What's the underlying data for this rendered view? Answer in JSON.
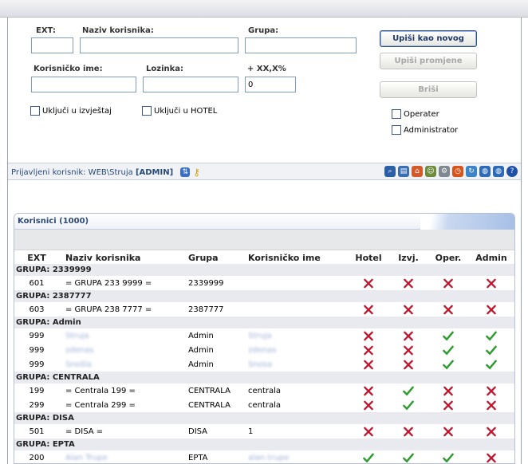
{
  "form": {
    "ext_label": "EXT:",
    "naziv_label": "Naziv korisnika:",
    "grupa_label": "Grupa:",
    "korisnicko_label": "Korisničko ime:",
    "lozinka_label": "Lozinka:",
    "postotak_label": "+ XX,X%",
    "postotak_value": "0",
    "ext_value": "",
    "naziv_value": "",
    "grupa_value": "",
    "korisnicko_value": "",
    "lozinka_value": "",
    "izvjestaj_label": "Uključi u izvještaj",
    "hotel_label": "Uključi u HOTEL",
    "operater_label": "Operater",
    "administrator_label": "Administrator"
  },
  "buttons": {
    "novi": "Upiši kao novog",
    "promjene": "Upiši promjene",
    "brisi": "Briši"
  },
  "status": {
    "prefix": "Prijavljeni korisnik: WEB\\Struja",
    "role": "[ADMIN]"
  },
  "panel": {
    "title": "Korisnici (1000)",
    "columns": {
      "ext": "EXT",
      "naziv": "Naziv korisnika",
      "grupa": "Grupa",
      "korisnicko": "Korisničko ime",
      "hotel": "Hotel",
      "izvj": "Izvj.",
      "oper": "Oper.",
      "admin": "Admin"
    },
    "rows": [
      {
        "type": "group",
        "label": "GRUPA: 2339999"
      },
      {
        "type": "row",
        "ext": "601",
        "naziv": "= GRUPA 233 9999 =",
        "grupa": "2339999",
        "korisnicko": "",
        "blur": false,
        "flags": [
          "no",
          "no",
          "no",
          "no"
        ]
      },
      {
        "type": "group",
        "label": "GRUPA: 2387777"
      },
      {
        "type": "row",
        "ext": "603",
        "naziv": "= GRUPA 238 7777 =",
        "grupa": "2387777",
        "korisnicko": "",
        "blur": false,
        "flags": [
          "no",
          "no",
          "no",
          "no"
        ]
      },
      {
        "type": "group",
        "label": "GRUPA: Admin"
      },
      {
        "type": "row",
        "ext": "999",
        "naziv": "Struja",
        "grupa": "Admin",
        "korisnicko": "Struja",
        "blur": true,
        "flags": [
          "no",
          "no",
          "yes",
          "yes"
        ]
      },
      {
        "type": "row",
        "ext": "999",
        "naziv": "zdenas",
        "grupa": "Admin",
        "korisnicko": "zdenas",
        "blur": true,
        "flags": [
          "no",
          "no",
          "yes",
          "yes"
        ]
      },
      {
        "type": "row",
        "ext": "999",
        "naziv": "Snošla",
        "grupa": "Admin",
        "korisnicko": "Snosa",
        "blur": true,
        "flags": [
          "no",
          "no",
          "yes",
          "yes"
        ]
      },
      {
        "type": "group",
        "label": "GRUPA: CENTRALA"
      },
      {
        "type": "row",
        "ext": "199",
        "naziv": "= Centrala 199 =",
        "grupa": "CENTRALA",
        "korisnicko": "centrala",
        "blur": false,
        "flags": [
          "no",
          "yes",
          "no",
          "no"
        ]
      },
      {
        "type": "row",
        "ext": "299",
        "naziv": "= Centrala 299 =",
        "grupa": "CENTRALA",
        "korisnicko": "centrala",
        "blur": false,
        "flags": [
          "no",
          "yes",
          "no",
          "no"
        ]
      },
      {
        "type": "group",
        "label": "GRUPA: DISA"
      },
      {
        "type": "row",
        "ext": "501",
        "naziv": "= DISA =",
        "grupa": "DISA",
        "korisnicko": "1",
        "blur": false,
        "flags": [
          "no",
          "no",
          "no",
          "no"
        ]
      },
      {
        "type": "group",
        "label": "GRUPA: EPTA"
      },
      {
        "type": "row",
        "ext": "200",
        "naziv": "Alan Trupe",
        "grupa": "EPTA",
        "korisnicko": "alan.trupe",
        "blur": true,
        "flags": [
          "yes",
          "yes",
          "yes",
          "no"
        ]
      }
    ]
  },
  "toolbar_icons": [
    "search-icon",
    "book-icon",
    "home-icon",
    "users-icon",
    "gear-icon",
    "clock-icon",
    "refresh-icon",
    "globe-icon",
    "globe-icon",
    "help-icon"
  ],
  "colors": {
    "check": "#2e9b2e",
    "cross": "#c0142c",
    "accent": "#2d4a78"
  }
}
